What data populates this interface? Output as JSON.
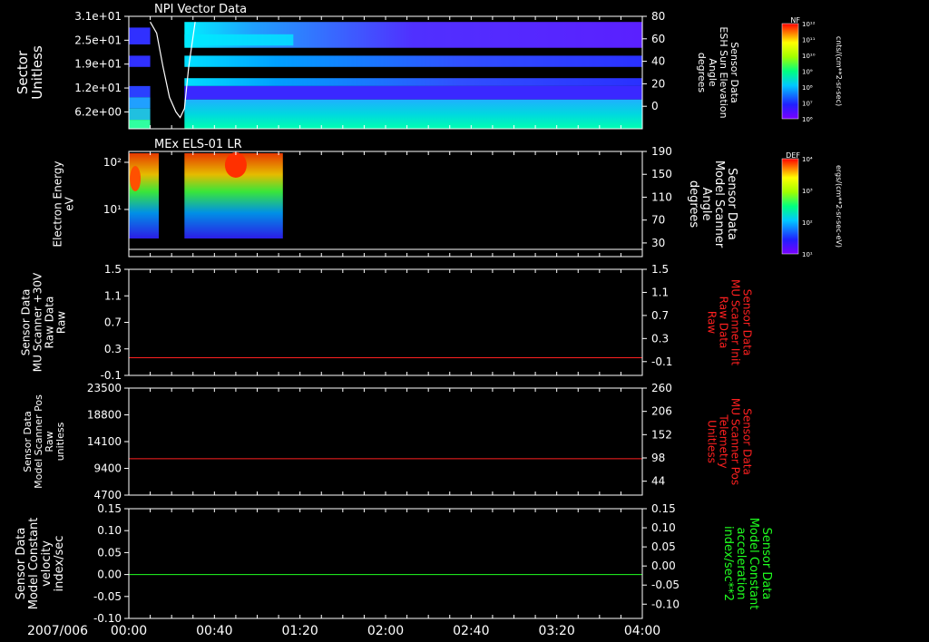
{
  "date_label": "2007/006",
  "time_axis": {
    "range_minutes": [
      0,
      240
    ],
    "ticks": [
      {
        "minute": 0,
        "label": "00:00"
      },
      {
        "minute": 40,
        "label": "00:40"
      },
      {
        "minute": 80,
        "label": "01:20"
      },
      {
        "minute": 120,
        "label": "02:00"
      },
      {
        "minute": 160,
        "label": "02:40"
      },
      {
        "minute": 200,
        "label": "03:20"
      },
      {
        "minute": 240,
        "label": "04:00"
      }
    ]
  },
  "colors": {
    "background": "#000000",
    "axis": "#ffffff",
    "red_trace": "#ff2020",
    "green_trace": "#20ff20",
    "white_trace": "#ffffff"
  },
  "chart_data": [
    {
      "type": "heatmap",
      "title": "NPI Vector Data",
      "ylabel": [
        "Sector",
        "Unitless"
      ],
      "left_ticks": [
        "3.1e+01",
        "2.5e+01",
        "1.9e+01",
        "1.2e+01",
        "6.2e+00"
      ],
      "right_ylabel": [
        "Sensor Data",
        "ESH Sun Elevation",
        "Angle",
        "degrees"
      ],
      "right_ticks": [
        "80",
        "60",
        "40",
        "20",
        "0"
      ],
      "right_ylim": [
        -20,
        80
      ],
      "colorbar": {
        "label": "NF",
        "units": "cnts/(cm**2-sr-sec)",
        "ticks": [
          "10¹²",
          "10¹¹",
          "10¹⁰",
          "10⁹",
          "10⁸",
          "10⁷",
          "10⁶"
        ]
      },
      "data_gaps_minutes": [
        [
          10,
          26
        ]
      ],
      "overlay_line": {
        "name": "Sensor Data ESH Sun Elevation Angle",
        "x": [
          10,
          13,
          16,
          19,
          22,
          24,
          26,
          28,
          31
        ],
        "y": [
          75,
          65,
          35,
          8,
          -5,
          -10,
          -2,
          35,
          75
        ]
      }
    },
    {
      "type": "heatmap",
      "title": "MEx ELS-01 LR",
      "ylabel": [
        "Electron Energy",
        "eV"
      ],
      "left_ticks": [
        "10²",
        "10¹"
      ],
      "right_ylabel": [
        "Sensor Data",
        "Model Scanner",
        "Angle",
        "degrees"
      ],
      "right_ticks": [
        "190",
        "150",
        "110",
        "70",
        "30"
      ],
      "right_ylim": [
        0,
        190
      ],
      "colorbar": {
        "label": "DEF",
        "units": "ergs/(cm**2-sr-sec-eV)",
        "ticks": [
          "10⁴",
          "10³",
          "10²",
          "10¹"
        ]
      },
      "data_minutes": [
        [
          0,
          14
        ],
        [
          26,
          72
        ]
      ]
    },
    {
      "type": "line",
      "ylabel": [
        "Sensor Data",
        "MU Scanner +30V",
        "Raw Data",
        "Raw"
      ],
      "left_ticks": [
        "1.5",
        "1.1",
        "0.7",
        "0.3",
        "-0.1"
      ],
      "ylim": [
        -0.3,
        1.5
      ],
      "right_ylabel": [
        "Sensor Data",
        "MU Scanner Init",
        "Raw Data",
        "Raw"
      ],
      "right_ticks": [
        "1.5",
        "1.1",
        "0.7",
        "0.3",
        "-0.1"
      ],
      "series": [
        {
          "name": "Sensor Data MU Scanner Init Raw Data",
          "x": [
            0,
            240
          ],
          "y": [
            0.0,
            0.0
          ],
          "color": "#ff2020"
        }
      ]
    },
    {
      "type": "line",
      "ylabel": [
        "Sensor Data",
        "Model Scanner Pos",
        "Raw",
        "unitless"
      ],
      "left_ticks": [
        "23500",
        "18800",
        "14100",
        "9400",
        "4700"
      ],
      "ylim": [
        0,
        23500
      ],
      "right_ylabel": [
        "Sensor Data",
        "MU Scanner Pos",
        "Telemetry",
        "Unitless"
      ],
      "right_ticks": [
        "260",
        "206",
        "152",
        "98",
        "44"
      ],
      "series": [
        {
          "name": "Sensor Data MU Scanner Pos Telemetry",
          "x": [
            0,
            240
          ],
          "y": [
            8000,
            8000
          ],
          "color": "#ff2020"
        }
      ]
    },
    {
      "type": "line",
      "ylabel": [
        "Sensor Data",
        "Model Constant",
        "velocity",
        "index/sec"
      ],
      "left_ticks": [
        "0.15",
        "0.10",
        "0.05",
        "0.00",
        "-0.05",
        "-0.10"
      ],
      "ylim": [
        -0.1,
        0.15
      ],
      "right_ylabel": [
        "Sensor Data",
        "Model Constant",
        "acceleration",
        "index/sec**2"
      ],
      "right_ticks": [
        "0.15",
        "0.10",
        "0.05",
        "0.00",
        "-0.05",
        "-0.10"
      ],
      "series": [
        {
          "name": "Sensor Data Model Constant acceleration",
          "x": [
            0,
            240
          ],
          "y": [
            0.0,
            0.0
          ],
          "color": "#20ff20"
        }
      ]
    }
  ]
}
